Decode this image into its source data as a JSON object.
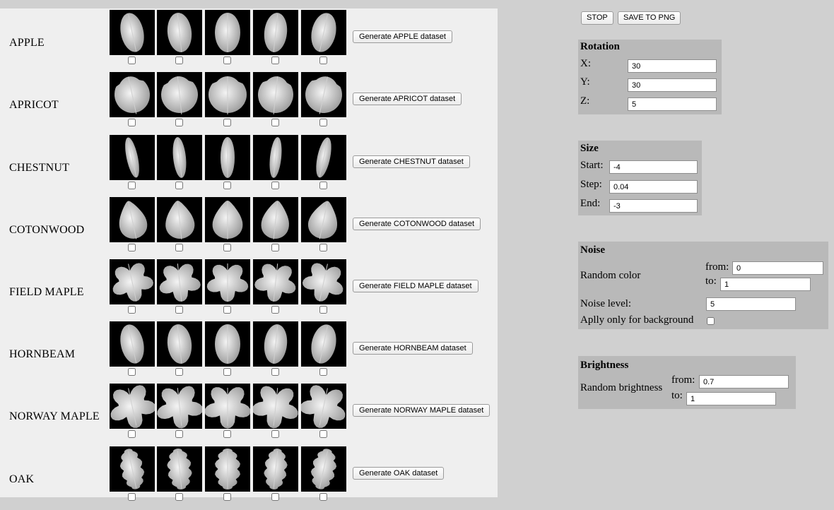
{
  "species": [
    {
      "name": "APPLE",
      "button": "Generate APPLE dataset"
    },
    {
      "name": "APRICOT",
      "button": "Generate APRICOT dataset"
    },
    {
      "name": "CHESTNUT",
      "button": "Generate CHESTNUT dataset"
    },
    {
      "name": "COTONWOOD",
      "button": "Generate COTONWOOD dataset"
    },
    {
      "name": "FIELD MAPLE",
      "button": "Generate FIELD MAPLE dataset"
    },
    {
      "name": "HORNBEAM",
      "button": "Generate HORNBEAM dataset"
    },
    {
      "name": "NORWAY MAPLE",
      "button": "Generate NORWAY MAPLE dataset"
    },
    {
      "name": "OAK",
      "button": "Generate OAK dataset"
    }
  ],
  "controls": {
    "stop_label": "STOP",
    "save_label": "SAVE TO PNG"
  },
  "rotation": {
    "title": "Rotation",
    "x_label": "X:",
    "x_value": "30",
    "y_label": "Y:",
    "y_value": "30",
    "z_label": "Z:",
    "z_value": "5"
  },
  "size": {
    "title": "Size",
    "start_label": "Start:",
    "start_value": "-4",
    "step_label": "Step:",
    "step_value": "0.04",
    "end_label": "End:",
    "end_value": "-3"
  },
  "noise": {
    "title": "Noise",
    "random_color_label": "Random color",
    "from_label": "from:",
    "from_value": "0",
    "to_label": "to:",
    "to_value": "1",
    "level_label": "Noise level:",
    "level_value": "5",
    "background_only_label": "Aplly only for background"
  },
  "brightness": {
    "title": "Brightness",
    "random_label": "Random brightness",
    "from_label": "from:",
    "from_value": "0.7",
    "to_label": "to:",
    "to_value": "1"
  },
  "colors": {
    "left_bg": "#efefef",
    "right_bg": "#d0d0d0",
    "panel_bg": "#b9b9b9",
    "thumb_bg": "#000000"
  }
}
